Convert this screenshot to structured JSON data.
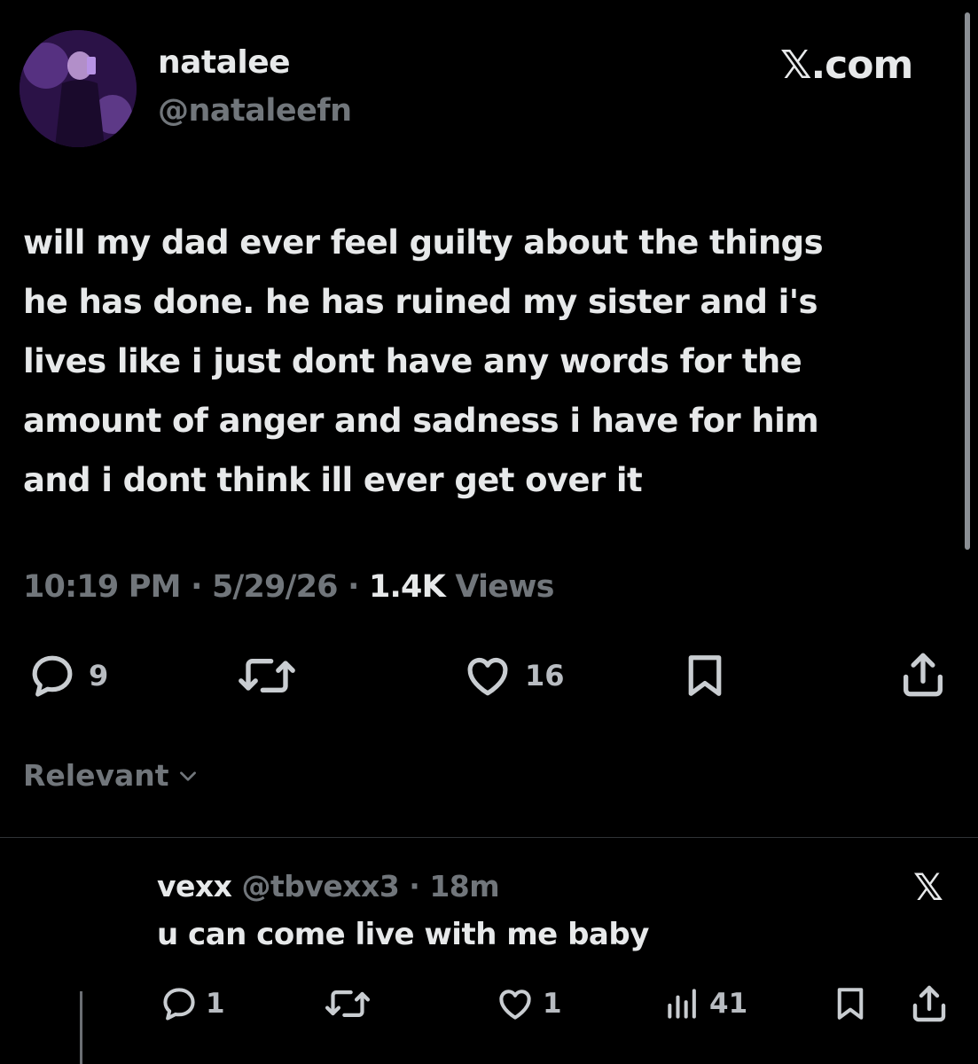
{
  "post": {
    "display_name": "natalee",
    "handle": "@nataleefn",
    "brand": "𝕏.com",
    "text": "will my dad ever feel guilty about the things\nhe has done. he has ruined my sister and i's\nlives like i just dont have any words for the\namount of anger and sadness i have for him\nand i dont think ill ever get over it",
    "time": "10:19 PM",
    "date": "5/29/26",
    "views_count": "1.4K",
    "views_label": "Views",
    "separator": "·",
    "reply_count": "9",
    "like_count": "16"
  },
  "sort": {
    "label": "Relevant"
  },
  "reply": {
    "display_name": "vexx",
    "handle": "@tbvexx3",
    "separator": "·",
    "age": "18m",
    "text": "u can come live with me baby",
    "badge": "𝕏",
    "reply_count": "1",
    "like_count": "1",
    "views_count": "41"
  },
  "icons": {
    "reply": "reply-icon",
    "repost": "repost-icon",
    "like": "heart-icon",
    "bookmark": "bookmark-icon",
    "share": "share-icon",
    "views": "views-icon",
    "chevron": "chevron-down-icon"
  },
  "colors": {
    "background": "#000000",
    "text": "#e7e9ea",
    "muted": "#71767b",
    "divider": "#2f3336"
  }
}
